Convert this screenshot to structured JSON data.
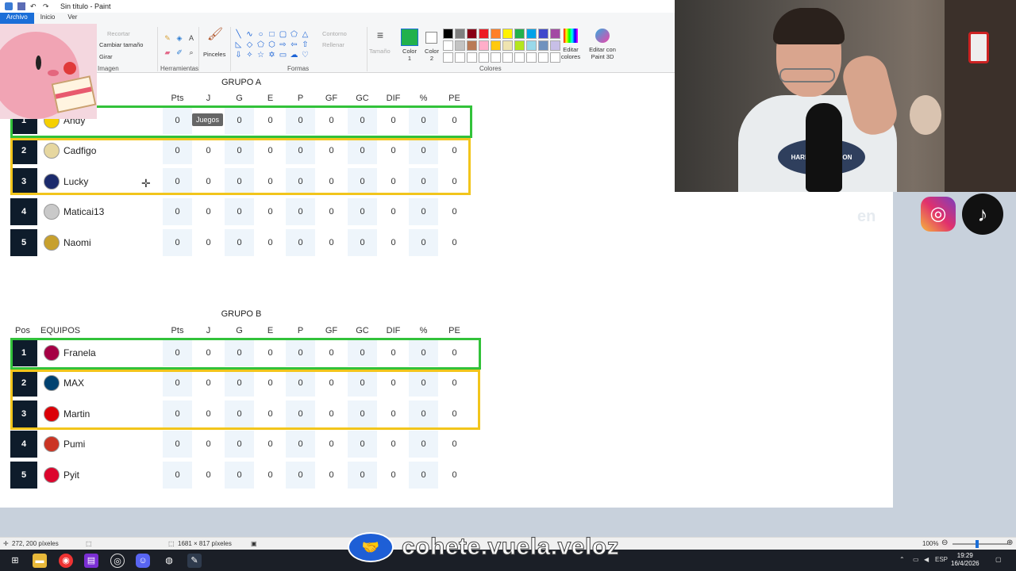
{
  "window": {
    "title": "Sin título - Paint"
  },
  "ribbon": {
    "tabs": [
      "Archivo",
      "Inicio",
      "Ver"
    ],
    "image_group": {
      "label": "Imagen",
      "recortar": "Recortar",
      "cambiar": "Cambiar tamaño",
      "girar": "Girar"
    },
    "tools_group": {
      "label": "Herramientas"
    },
    "brushes": "Pinceles",
    "shapes_group": {
      "label": "Formas",
      "contorno": "Contorno",
      "rellenar": "Rellenar"
    },
    "size": "Tamaño",
    "color1": "Color 1",
    "color2": "Color 2",
    "colors_label": "Colores",
    "edit_colors": "Editar colores",
    "paint3d": "Editar con Paint 3D",
    "palette": [
      "#000000",
      "#7f7f7f",
      "#880015",
      "#ed1c24",
      "#ff7f27",
      "#fff200",
      "#22b14c",
      "#00a2e8",
      "#3f48cc",
      "#a349a4",
      "#ffffff",
      "#c3c3c3",
      "#b97a57",
      "#ffaec9",
      "#ffc90e",
      "#efe4b0",
      "#b5e61d",
      "#99d9ea",
      "#7092be",
      "#c8bfe7",
      "#ffffff",
      "#ffffff",
      "#ffffff",
      "#ffffff",
      "#ffffff",
      "#ffffff",
      "#ffffff",
      "#ffffff",
      "#ffffff",
      "#ffffff"
    ],
    "color1_value": "#22b14c",
    "color2_value": "#ffffff"
  },
  "groupA": {
    "title": "GRUPO A",
    "columns": [
      "Pts",
      "J",
      "G",
      "E",
      "P",
      "GF",
      "GC",
      "DIF",
      "%",
      "PE"
    ],
    "rows": [
      {
        "pos": "1",
        "team": "Andy",
        "crest": "#f5d000",
        "values": [
          "0",
          "0",
          "0",
          "0",
          "0",
          "0",
          "0",
          "0",
          "0",
          "0"
        ]
      },
      {
        "pos": "2",
        "team": "Cadfigo",
        "crest": "#e6d7a0",
        "values": [
          "0",
          "0",
          "0",
          "0",
          "0",
          "0",
          "0",
          "0",
          "0",
          "0"
        ]
      },
      {
        "pos": "3",
        "team": "Lucky",
        "crest": "#1b2a6b",
        "values": [
          "0",
          "0",
          "0",
          "0",
          "0",
          "0",
          "0",
          "0",
          "0",
          "0"
        ]
      },
      {
        "pos": "4",
        "team": "Maticai13",
        "crest": "#c9c9c9",
        "values": [
          "0",
          "0",
          "0",
          "0",
          "0",
          "0",
          "0",
          "0",
          "0",
          "0"
        ]
      },
      {
        "pos": "5",
        "team": "Naomi",
        "crest": "#c7a02e",
        "values": [
          "0",
          "0",
          "0",
          "0",
          "0",
          "0",
          "0",
          "0",
          "0",
          "0"
        ]
      }
    ],
    "tooltip": "Juegos"
  },
  "groupB": {
    "title": "GRUPO B",
    "pos_header": "Pos",
    "teams_header": "EQUIPOS",
    "columns": [
      "Pts",
      "J",
      "G",
      "E",
      "P",
      "GF",
      "GC",
      "DIF",
      "%",
      "PE"
    ],
    "rows": [
      {
        "pos": "1",
        "team": "Franela",
        "crest": "#a50044",
        "values": [
          "0",
          "0",
          "0",
          "0",
          "0",
          "0",
          "0",
          "0",
          "0",
          "0"
        ]
      },
      {
        "pos": "2",
        "team": "MAX",
        "crest": "#004170",
        "values": [
          "0",
          "0",
          "0",
          "0",
          "0",
          "0",
          "0",
          "0",
          "0",
          "0"
        ]
      },
      {
        "pos": "3",
        "team": "Martin",
        "crest": "#db0007",
        "values": [
          "0",
          "0",
          "0",
          "0",
          "0",
          "0",
          "0",
          "0",
          "0",
          "0"
        ]
      },
      {
        "pos": "4",
        "team": "Pumi",
        "crest": "#cb3524",
        "values": [
          "0",
          "0",
          "0",
          "0",
          "0",
          "0",
          "0",
          "0",
          "0",
          "0"
        ]
      },
      {
        "pos": "5",
        "team": "Pyit",
        "crest": "#dc052d",
        "values": [
          "0",
          "0",
          "0",
          "0",
          "0",
          "0",
          "0",
          "0",
          "0",
          "0"
        ]
      }
    ]
  },
  "overlay": {
    "ghost_text": "en"
  },
  "shirt_text": "HARLEY-DAVIDSON",
  "statusbar": {
    "cursor_pos": "272, 200 píxeles",
    "canvas_size": "1681 × 817 píxeles",
    "zoom": "100%"
  },
  "watermark": {
    "text": "cohete.vuela.veloz"
  },
  "taskbar": {
    "lang": "ESP",
    "time": "19:29",
    "date": "16/4/2026"
  }
}
